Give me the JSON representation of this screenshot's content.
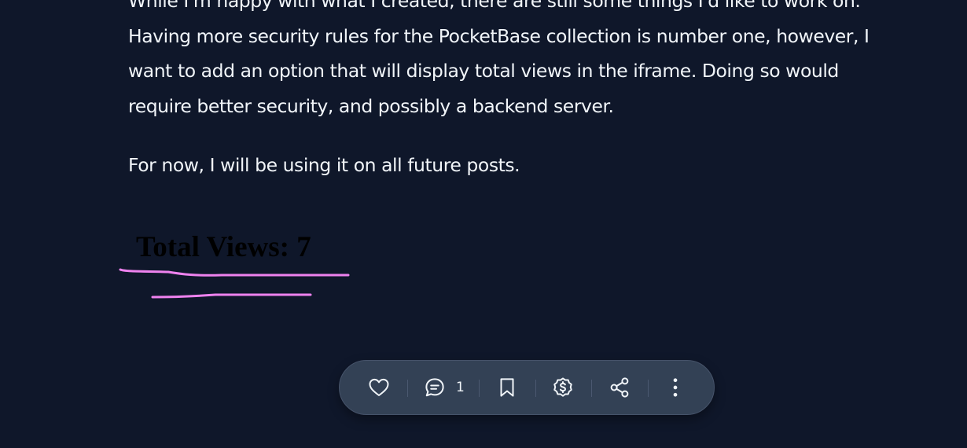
{
  "article": {
    "paragraphs": [
      "While I'm happy with what I created, there are still some things I'd like to work on.",
      "Having more security rules for the PocketBase collection is number one, however, I",
      "want to add an option that will display total views in the iframe. Doing so would",
      "require better security, and possibly a backend server.",
      "For now, I will be using it on all future posts."
    ]
  },
  "embed": {
    "total_views_label": "Total Views: 7"
  },
  "toolbar": {
    "comment_count": "1",
    "icons": [
      "heart-icon",
      "comment-icon",
      "bookmark-icon",
      "dollar-coin-icon",
      "share-icon",
      "more-vertical-icon"
    ]
  },
  "colors": {
    "background": "#0f172a",
    "text": "#f1f5f9",
    "toolbar": "#334155",
    "annotation": "#ee82ee"
  }
}
